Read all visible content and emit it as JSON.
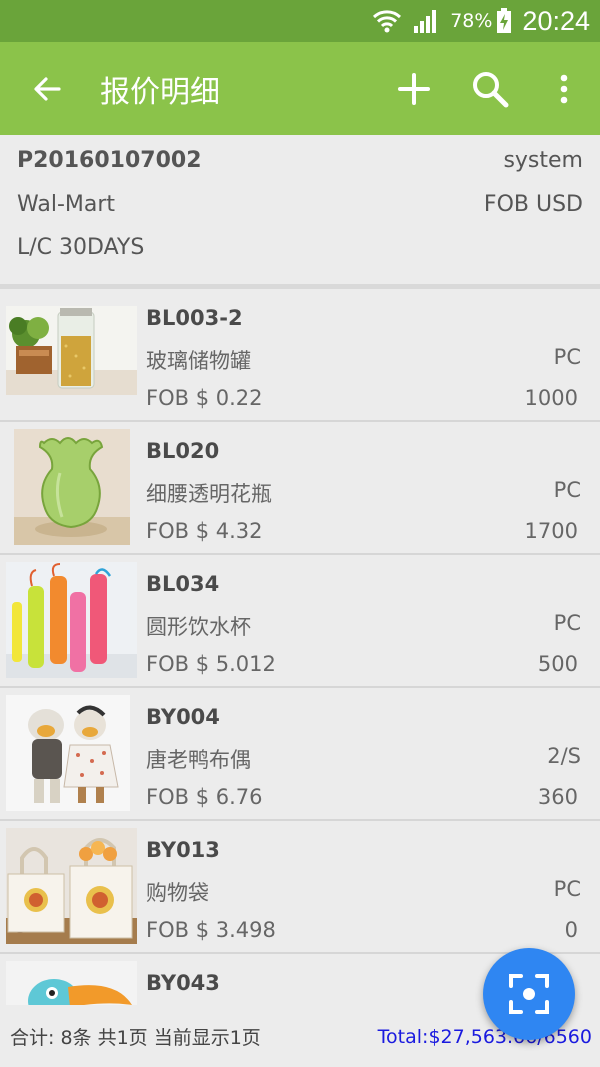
{
  "status_bar": {
    "battery": "78%",
    "time": "20:24"
  },
  "app_bar": {
    "title": "报价明细",
    "icons": [
      "back-arrow-icon",
      "add-icon",
      "search-icon",
      "more-vert-icon"
    ]
  },
  "header": {
    "quote_no": "P20160107002",
    "user": "system",
    "customer": "Wal-Mart",
    "terms": "FOB USD",
    "payment": "L/C 30DAYS"
  },
  "items": [
    {
      "code": "BL003-2",
      "name": "玻璃储物罐",
      "unit": "PC",
      "price": "FOB $ 0.22",
      "qty": "1000"
    },
    {
      "code": "BL020",
      "name": "细腰透明花瓶",
      "unit": "PC",
      "price": "FOB $ 4.32",
      "qty": "1700"
    },
    {
      "code": "BL034",
      "name": "圆形饮水杯",
      "unit": "PC",
      "price": "FOB $ 5.012",
      "qty": "500"
    },
    {
      "code": "BY004",
      "name": "唐老鸭布偶",
      "unit": "2/S",
      "price": "FOB $ 6.76",
      "qty": "360"
    },
    {
      "code": "BY013",
      "name": "购物袋",
      "unit": "PC",
      "price": "FOB $ 3.498",
      "qty": "0"
    },
    {
      "code": "BY043",
      "name": "",
      "unit": "",
      "price": "",
      "qty": ""
    }
  ],
  "footer": {
    "summary": "合计: 8条 共1页 当前显示1页",
    "total": "Total:$27,563.66/6560"
  },
  "fab": {
    "icon": "scan-icon"
  },
  "colors": {
    "status_bar": "#6aa43a",
    "app_bar": "#8bc34a",
    "fab": "#2f86f2",
    "total_text": "#1a1adf"
  }
}
